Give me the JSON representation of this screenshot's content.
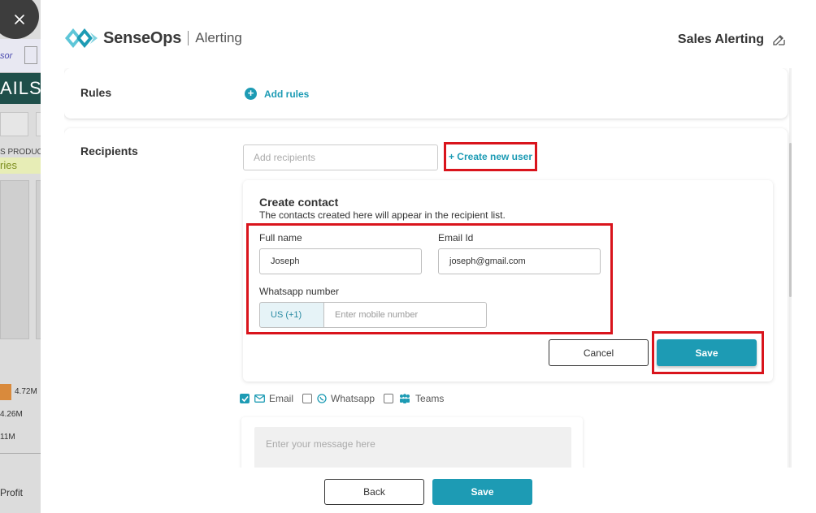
{
  "background": {
    "link_text": "sor",
    "banner_text": "AILS",
    "product_text": "S PRODUC",
    "series_text": "ries",
    "values": [
      "4.72M",
      "4.26M",
      "11M"
    ],
    "profit_label": "Profit"
  },
  "header": {
    "brand_name": "SenseOps",
    "brand_sub": "Alerting",
    "alert_name": "Sales Alerting"
  },
  "rules": {
    "label": "Rules",
    "add_label": "Add rules"
  },
  "recipients": {
    "label": "Recipients",
    "placeholder": "Add recipients",
    "create_user_label": "+ Create new user"
  },
  "create_contact": {
    "title": "Create contact",
    "subtitle": "The contacts created here will appear in the recipient list.",
    "full_name_label": "Full name",
    "full_name_value": "Joseph",
    "email_label": "Email Id",
    "email_value": "joseph@gmail.com",
    "whatsapp_label": "Whatsapp number",
    "country_code": "US (+1)",
    "mobile_placeholder": "Enter mobile number",
    "cancel_label": "Cancel",
    "save_label": "Save"
  },
  "channels": {
    "email": {
      "label": "Email",
      "checked": true
    },
    "whatsapp": {
      "label": "Whatsapp",
      "checked": false
    },
    "teams": {
      "label": "Teams",
      "checked": false
    }
  },
  "message": {
    "placeholder": "Enter your message here"
  },
  "footer": {
    "back_label": "Back",
    "save_label": "Save"
  },
  "colors": {
    "accent": "#1d9bb4",
    "highlight": "#d9141c"
  }
}
